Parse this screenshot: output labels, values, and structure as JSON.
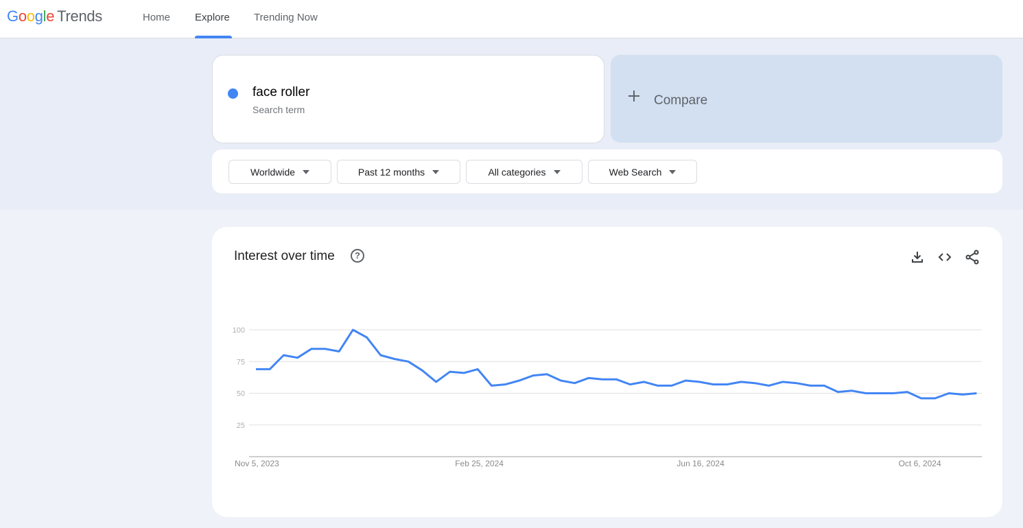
{
  "header": {
    "logo_google": [
      "G",
      "o",
      "o",
      "g",
      "l",
      "e"
    ],
    "logo_product": "Trends",
    "nav": [
      {
        "label": "Home",
        "active": false
      },
      {
        "label": "Explore",
        "active": true
      },
      {
        "label": "Trending Now",
        "active": false
      }
    ]
  },
  "search": {
    "term": "face roller",
    "term_type": "Search term",
    "term_color": "#4285f4",
    "compare_label": "Compare"
  },
  "filters": [
    {
      "label": "Worldwide"
    },
    {
      "label": "Past 12 months"
    },
    {
      "label": "All categories"
    },
    {
      "label": "Web Search"
    }
  ],
  "interest_card": {
    "title": "Interest over time",
    "icons": [
      "help-icon",
      "download-icon",
      "embed-code-icon",
      "share-icon"
    ]
  },
  "chart_data": {
    "type": "line",
    "title": "Interest over time",
    "xlabel": "",
    "ylabel": "",
    "ylim": [
      0,
      100
    ],
    "yticks": [
      25,
      50,
      75,
      100
    ],
    "xtick_labels": [
      {
        "label": "Nov 5, 2023",
        "index": 0
      },
      {
        "label": "Feb 25, 2024",
        "index": 16
      },
      {
        "label": "Jun 16, 2024",
        "index": 32
      },
      {
        "label": "Oct 6, 2024",
        "index": 48
      }
    ],
    "grid": true,
    "series": [
      {
        "name": "face roller",
        "color": "#4285f4",
        "values": [
          69,
          69,
          80,
          78,
          85,
          85,
          83,
          100,
          94,
          80,
          77,
          75,
          68,
          59,
          67,
          66,
          69,
          56,
          57,
          60,
          64,
          65,
          60,
          58,
          62,
          61,
          61,
          57,
          59,
          56,
          56,
          60,
          59,
          57,
          57,
          59,
          58,
          56,
          59,
          58,
          56,
          56,
          51,
          52,
          50,
          50,
          50,
          51,
          46,
          46,
          50,
          49,
          50
        ]
      }
    ]
  }
}
